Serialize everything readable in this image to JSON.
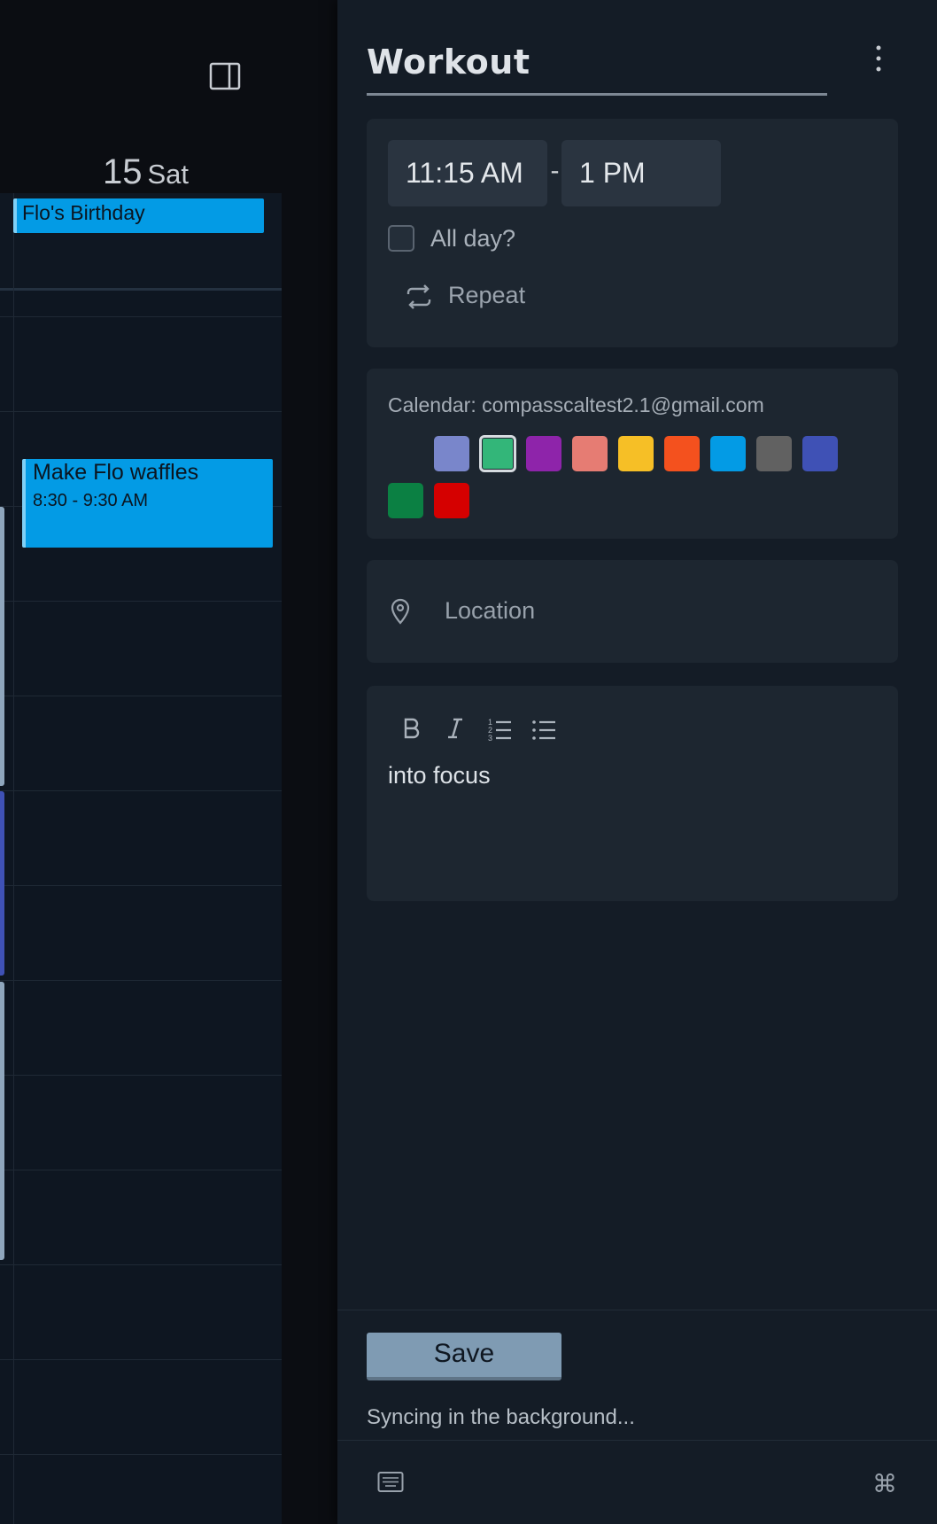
{
  "calendar": {
    "day_number": "15",
    "day_name": "Sat",
    "events": {
      "birthday": {
        "title": "Flo's Birthday"
      },
      "waffles": {
        "title": "Make Flo waffles",
        "time": "8:30 - 9:30 AM"
      }
    },
    "event_color": "#039be5"
  },
  "form": {
    "title": "Workout",
    "start_time": "11:15 AM",
    "time_separator": "-",
    "end_time": "1 PM",
    "all_day_label": "All day?",
    "all_day_checked": false,
    "repeat_label": "Repeat",
    "calendar_label": "Calendar: compasscaltest2.1@gmail.com",
    "colors": [
      "#7986cb",
      "#33b679",
      "#8e24aa",
      "#e67c73",
      "#f6bf26",
      "#f4511e",
      "#039be5",
      "#616161",
      "#3f51b5",
      "#0b8043",
      "#d50000"
    ],
    "selected_color": "#33b679",
    "location_placeholder": "Location",
    "toolbar": {
      "bold_icon": "bold-icon",
      "italic_icon": "italic-icon",
      "ordered_list_icon": "ordered-list-icon",
      "bullet_list_icon": "bullet-list-icon"
    },
    "description": "into focus",
    "save_label": "Save",
    "status_text": "Syncing in the background..."
  },
  "footer": {
    "keyboard_icon": "keyboard-icon",
    "command_icon": "command-icon",
    "command_glyph": "⌘"
  }
}
